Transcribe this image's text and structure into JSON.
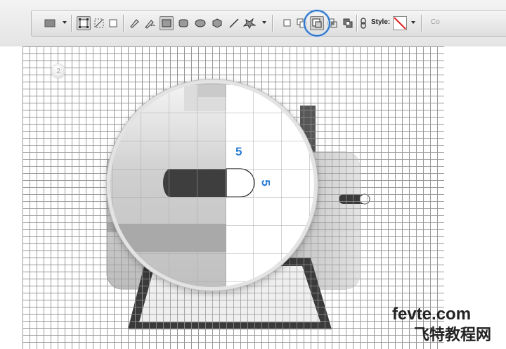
{
  "options_bar": {
    "style_label": "Style:",
    "cut_text": "Co",
    "tool_icons": [
      "rectangle-tool-icon",
      "dropdown-arrow-icon",
      "shape-layers-icon",
      "paths-icon",
      "fill-pixels-icon",
      "pen-icon",
      "freeform-pen-icon",
      "rectangle-icon",
      "rounded-rectangle-icon",
      "ellipse-icon",
      "polygon-icon",
      "line-icon",
      "custom-shape-icon",
      "dropdown-arrow-icon",
      "new-layer-icon",
      "add-to-area-icon",
      "subtract-from-area-icon",
      "intersect-areas-icon",
      "exclude-overlap-icon",
      "link-icon",
      "style-swatch-icon",
      "dropdown-arrow-icon"
    ],
    "highlight_color": "#2b73c6"
  },
  "canvas": {
    "step_number": "2",
    "zoom_label_top": "5",
    "zoom_label_side": "5",
    "label_color": "#2c7fd6",
    "grid_color": "#a9a9a9"
  },
  "watermark": {
    "line1": "fevte.com",
    "line2": "飞特教程网"
  }
}
